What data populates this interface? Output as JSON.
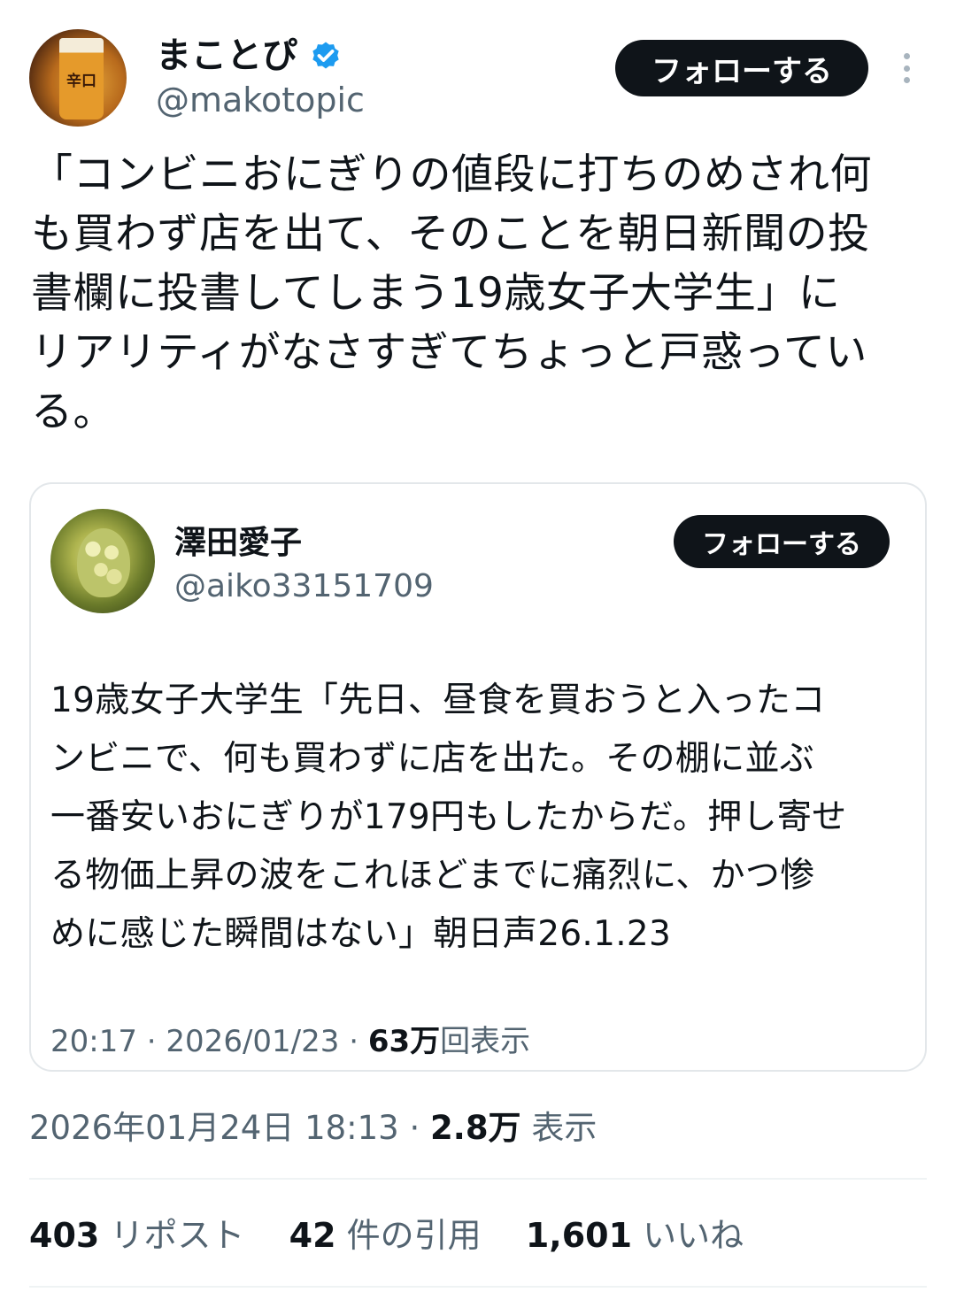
{
  "tweet": {
    "author": {
      "name": "まことぴ",
      "handle": "@makotopic",
      "avatar_label": "辛口",
      "verified": true
    },
    "follow_label": "フォローする",
    "more_icon": "more-vertical-icon",
    "text": "「コンビニおにぎりの値段に打ちのめされ何\nも買わず店を出て、そのことを朝日新聞の投\n書欄に投書してしまう19歳女子大学生」に\nリアリティがなさすぎてちょっと戸惑ってい\nる。",
    "timestamp": "2026年01月24日 18:13",
    "separator": "·",
    "views_count": "2.8万",
    "views_label": "表示"
  },
  "quote": {
    "author": {
      "name": "澤田愛子",
      "handle": "@aiko33151709"
    },
    "follow_label": "フォローする",
    "text": "19歳女子大学生「先日、昼食を買おうと入ったコ\nンビニで、何も買わずに店を出た。その棚に並ぶ\n一番安いおにぎりが179円もしたからだ。押し寄せ\nる物価上昇の波をこれほどまでに痛烈に、かつ惨\nめに感じた瞬間はない」朝日声26.1.23",
    "time": "20:17",
    "date": "2026/01/23",
    "separator": "·",
    "views_count": "63万",
    "views_label": "回表示"
  },
  "stats": {
    "reposts_count": "403",
    "reposts_label": "リポスト",
    "quotes_count": "42",
    "quotes_label": "件の引用",
    "likes_count": "1,601",
    "likes_label": "いいね"
  },
  "colors": {
    "text_primary": "#0f1419",
    "text_secondary": "#536471",
    "verified_blue": "#1d9bf0",
    "button_bg": "#0f1419",
    "border": "#e3e7ea"
  }
}
